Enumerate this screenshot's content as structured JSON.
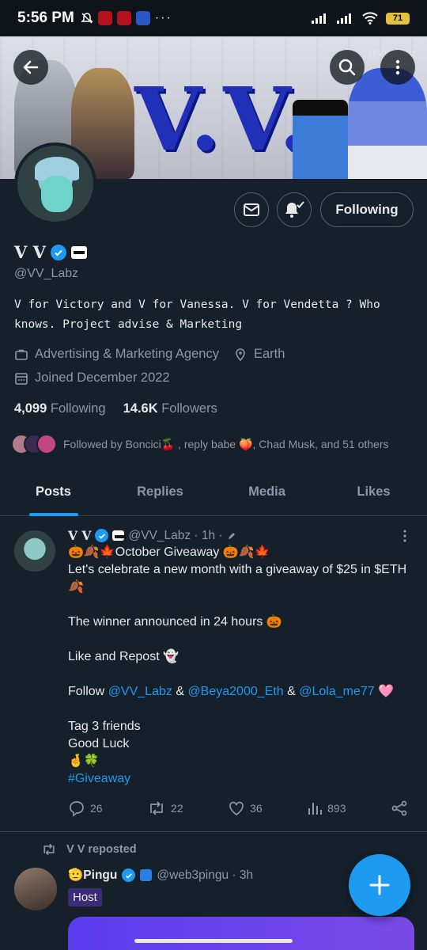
{
  "status_bar": {
    "time": "5:56 PM",
    "battery": "71"
  },
  "banner": {
    "handle_watermark": "@VV_Labz",
    "logo_text": "V.V."
  },
  "profile": {
    "name": "V V",
    "handle": "@VV_Labz",
    "bio": "V for Victory and V for Vanessa.  V for Vendetta ? Who knows. Project advise & Marketing",
    "category": "Advertising & Marketing Agency",
    "location": "Earth",
    "joined": "Joined December 2022",
    "following_count": "4,099",
    "following_label": "Following",
    "followers_count": "14.6K",
    "followers_label": "Followers",
    "followed_by": "Followed by Boncici🍒 , reply babe 🍑, Chad Musk, and 51 others",
    "follow_button": "Following"
  },
  "tabs": [
    {
      "label": "Posts",
      "active": true
    },
    {
      "label": "Replies",
      "active": false
    },
    {
      "label": "Media",
      "active": false
    },
    {
      "label": "Likes",
      "active": false
    }
  ],
  "tweet": {
    "name": "V V",
    "handle_time": "@VV_Labz · 1h ·",
    "lines": {
      "l1": "🎃🍂🍁October Giveaway 🎃🍂🍁",
      "l2": "Let's celebrate a new month with a giveaway of $25 in $ETH🍂",
      "l3": "The winner announced in 24 hours 🎃",
      "l4": "Like and Repost 👻",
      "follow_prefix": "Follow ",
      "mention1": "@VV_Labz",
      "amp1": " & ",
      "mention2": "@Beya2000_Eth",
      "amp2": " & ",
      "mention3": "@Lola_me77",
      "heart": " 🩷",
      "l6": "Tag 3 friends",
      "l7": "Good Luck",
      "l8": "🤞🍀",
      "hashtag": "#Giveaway"
    },
    "replies": "26",
    "reposts": "22",
    "likes": "36",
    "views": "893"
  },
  "repost": {
    "label": "V V reposted",
    "name": "🫡Pingu",
    "handle_time": "@web3pingu · 3h",
    "badge": "Host"
  },
  "colors": {
    "accent": "#1d9bf0",
    "background": "#15202b"
  }
}
